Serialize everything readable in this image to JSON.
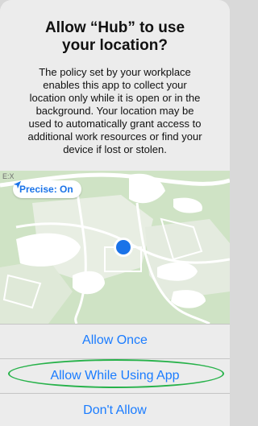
{
  "alert": {
    "title_lines": [
      "Allow “Hub” to use",
      "your location?"
    ],
    "message_lines": [
      "The policy set by your workplace",
      "enables this app to collect your",
      "location only while it is open or in the",
      "background. Your location may be",
      "used to automatically grant access to",
      "additional work resources or find your",
      "device if lost or stolen."
    ]
  },
  "map": {
    "precise_label": "Precise: On",
    "corner_text": "E:X"
  },
  "buttons": {
    "allow_once": "Allow Once",
    "allow_while_using": "Allow While Using App",
    "dont_allow": "Don't Allow"
  },
  "colors": {
    "accent": "#1a7cff",
    "location_dot": "#1a73e8",
    "highlight": "#27b24a",
    "alert_bg": "#ececec",
    "map_land": "#cfe3c5"
  },
  "icons": {
    "location_arrow": "location-arrow-icon",
    "user_location": "user-location-dot-icon"
  }
}
